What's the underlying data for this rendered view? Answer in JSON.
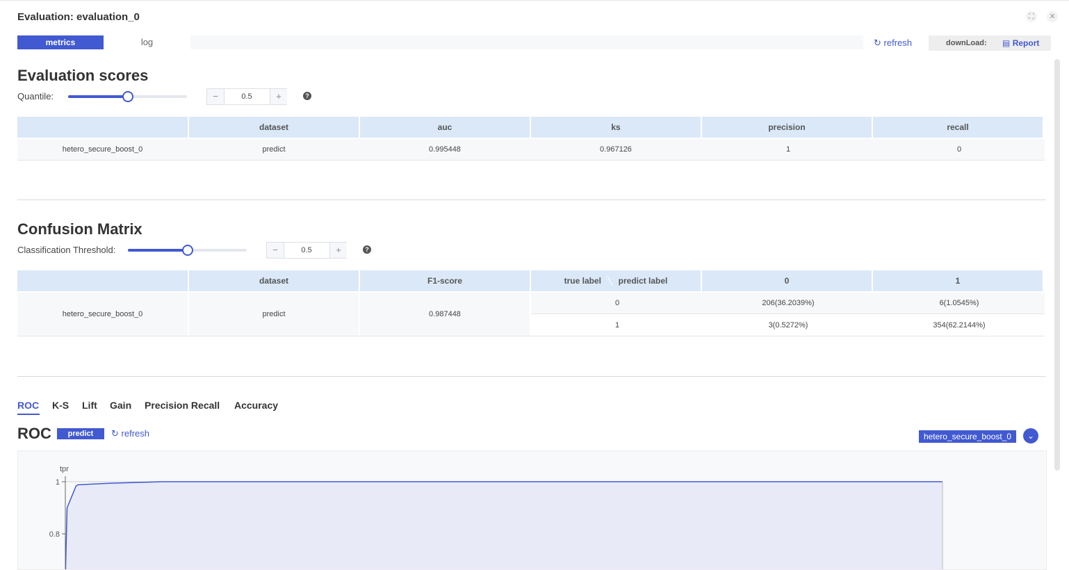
{
  "window": {
    "title": "Evaluation: evaluation_0",
    "icons": [
      "fullscreen-icon",
      "close-icon"
    ]
  },
  "tabs": [
    {
      "label": "metrics",
      "active": true
    },
    {
      "label": "log",
      "active": false
    }
  ],
  "toolbar": {
    "refresh_label": "refresh",
    "download_label": "downLoad:",
    "report_label": "Report"
  },
  "evaluation_scores": {
    "title": "Evaluation scores",
    "quantile_label": "Quantile:",
    "quantile_value": "0.5",
    "quantile_level": 0.5,
    "columns": [
      "",
      "dataset",
      "auc",
      "ks",
      "precision",
      "recall"
    ],
    "rows": [
      [
        "hetero_secure_boost_0",
        "predict",
        "0.995448",
        "0.967126",
        "1",
        "0"
      ]
    ]
  },
  "confusion_matrix": {
    "title": "Confusion Matrix",
    "threshold_label": "Classification Threshold:",
    "threshold_value": "0.5",
    "threshold_level": 0.5,
    "columns": [
      "",
      "dataset",
      "F1-score",
      "true label",
      "predict label",
      "0",
      "1"
    ],
    "row": {
      "model": "hetero_secure_boost_0",
      "dataset": "predict",
      "f1": "0.987448",
      "lines": [
        {
          "true_label": "0",
          "pred_0": "206(36.2039%)",
          "pred_1": "6(1.0545%)"
        },
        {
          "true_label": "1",
          "pred_0": "3(0.5272%)",
          "pred_1": "354(62.2144%)"
        }
      ]
    }
  },
  "curve_tabs": [
    "ROC",
    "K-S",
    "Lift",
    "Gain",
    "Precision Recall",
    "Accuracy"
  ],
  "roc": {
    "title": "ROC",
    "badge": "predict",
    "refresh_label": "refresh",
    "model_select": "hetero_secure_boost_0"
  },
  "chart_data": {
    "type": "area",
    "title": "",
    "ylabel": "tpr",
    "xlabel": "",
    "y_ticks": [
      "1",
      "0.8"
    ],
    "ylim": [
      0.8,
      1
    ],
    "series": [
      {
        "color": "#4159d1",
        "x": [
          0,
          0.002,
          0.012,
          0.014,
          0.025,
          0.05,
          0.11,
          1.0
        ],
        "y": [
          0.63,
          0.9,
          0.982,
          0.988,
          0.99,
          0.994,
          1.0,
          1.0
        ]
      }
    ]
  },
  "colors": {
    "accent": "#4159d1",
    "header_bg": "#dbe8f8",
    "area_fill": "#e8eaf8"
  }
}
